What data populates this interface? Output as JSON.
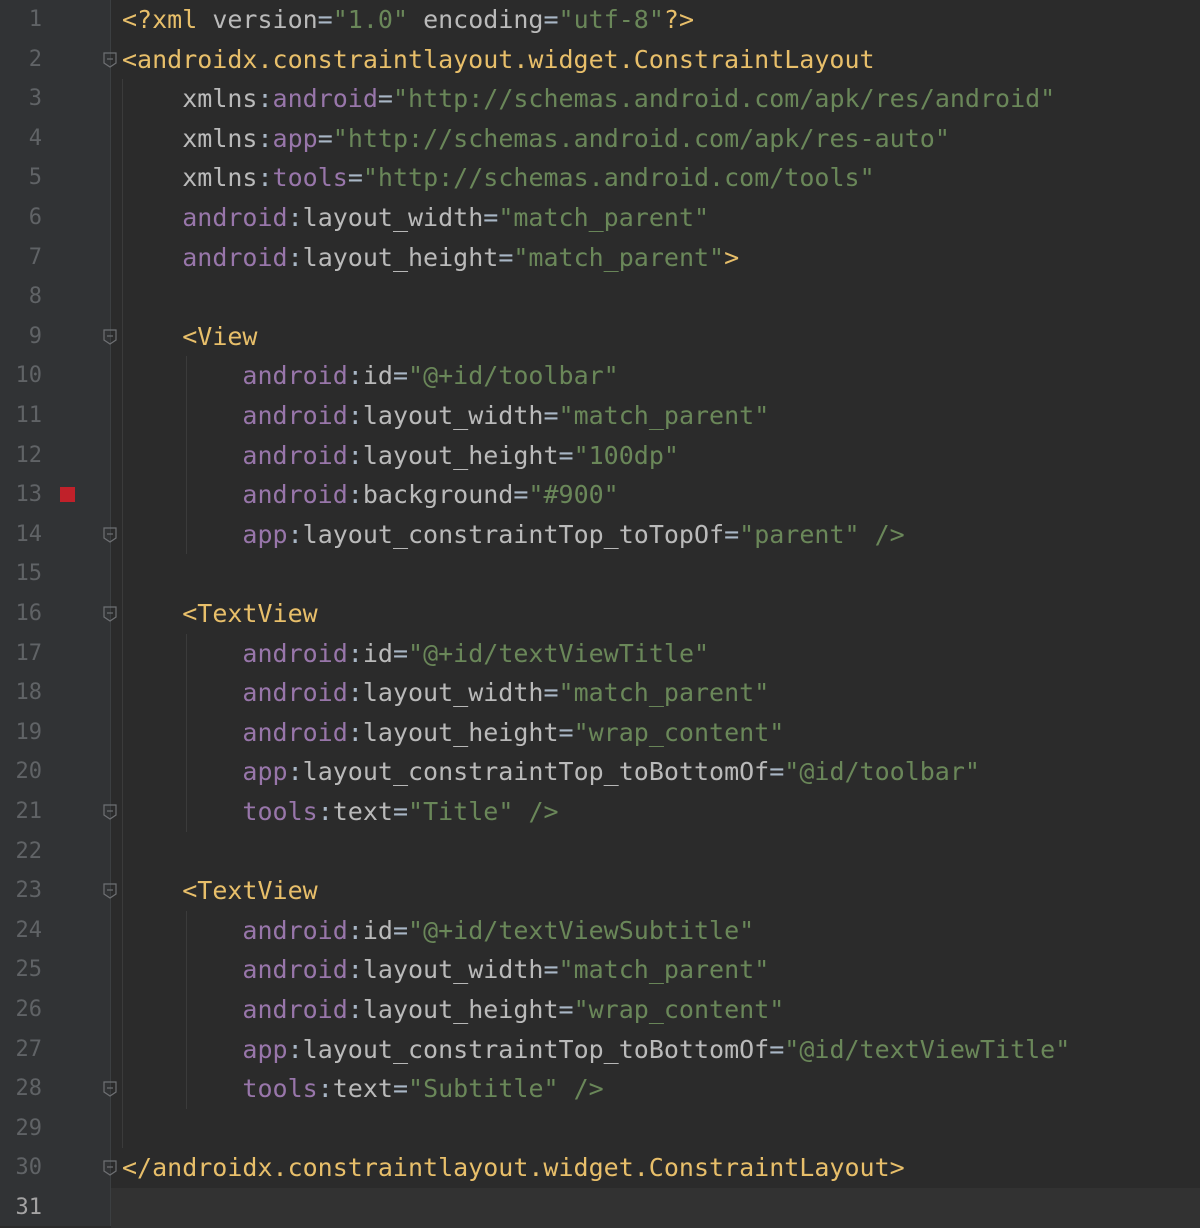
{
  "editor": {
    "language": "xml",
    "active_line": 31,
    "breakpoint_line": 13,
    "colors": {
      "background": "#2b2b2b",
      "gutter": "#313335",
      "tag": "#e8bf6a",
      "attribute": "#bababa",
      "namespace": "#9876aa",
      "value": "#6a8759",
      "line_number": "#606366",
      "breakpoint": "#c0212a"
    },
    "fold_markers": [
      2,
      9,
      14,
      16,
      21,
      23,
      28,
      30
    ],
    "line_numbers": [
      "1",
      "2",
      "3",
      "4",
      "5",
      "6",
      "7",
      "8",
      "9",
      "10",
      "11",
      "12",
      "13",
      "14",
      "15",
      "16",
      "17",
      "18",
      "19",
      "20",
      "21",
      "22",
      "23",
      "24",
      "25",
      "26",
      "27",
      "28",
      "29",
      "30",
      "31"
    ],
    "lines": [
      [
        [
          "tag",
          "<?xml "
        ],
        [
          "attr",
          "version"
        ],
        [
          "punct",
          "="
        ],
        [
          "val",
          "\"1.0\""
        ],
        [
          "punct",
          " "
        ],
        [
          "attr",
          "encoding"
        ],
        [
          "punct",
          "="
        ],
        [
          "val",
          "\"utf-8\""
        ],
        [
          "tag",
          "?>"
        ]
      ],
      [
        [
          "tag",
          "<androidx.constraintlayout.widget.ConstraintLayout"
        ]
      ],
      [
        [
          "punct",
          "    "
        ],
        [
          "attr",
          "xmlns"
        ],
        [
          "punct",
          ":"
        ],
        [
          "ns",
          "android"
        ],
        [
          "punct",
          "="
        ],
        [
          "val",
          "\"http://schemas.android.com/apk/res/android\""
        ]
      ],
      [
        [
          "punct",
          "    "
        ],
        [
          "attr",
          "xmlns"
        ],
        [
          "punct",
          ":"
        ],
        [
          "ns",
          "app"
        ],
        [
          "punct",
          "="
        ],
        [
          "val",
          "\"http://schemas.android.com/apk/res-auto\""
        ]
      ],
      [
        [
          "punct",
          "    "
        ],
        [
          "attr",
          "xmlns"
        ],
        [
          "punct",
          ":"
        ],
        [
          "ns",
          "tools"
        ],
        [
          "punct",
          "="
        ],
        [
          "val",
          "\"http://schemas.android.com/tools\""
        ]
      ],
      [
        [
          "punct",
          "    "
        ],
        [
          "ns",
          "android"
        ],
        [
          "punct",
          ":"
        ],
        [
          "attr",
          "layout_width"
        ],
        [
          "punct",
          "="
        ],
        [
          "val",
          "\"match_parent\""
        ]
      ],
      [
        [
          "punct",
          "    "
        ],
        [
          "ns",
          "android"
        ],
        [
          "punct",
          ":"
        ],
        [
          "attr",
          "layout_height"
        ],
        [
          "punct",
          "="
        ],
        [
          "val",
          "\"match_parent\""
        ],
        [
          "tag",
          ">"
        ]
      ],
      [],
      [
        [
          "punct",
          "    "
        ],
        [
          "tag",
          "<View"
        ]
      ],
      [
        [
          "punct",
          "        "
        ],
        [
          "ns",
          "android"
        ],
        [
          "punct",
          ":"
        ],
        [
          "attr",
          "id"
        ],
        [
          "punct",
          "="
        ],
        [
          "val",
          "\"@+id/toolbar\""
        ]
      ],
      [
        [
          "punct",
          "        "
        ],
        [
          "ns",
          "android"
        ],
        [
          "punct",
          ":"
        ],
        [
          "attr",
          "layout_width"
        ],
        [
          "punct",
          "="
        ],
        [
          "val",
          "\"match_parent\""
        ]
      ],
      [
        [
          "punct",
          "        "
        ],
        [
          "ns",
          "android"
        ],
        [
          "punct",
          ":"
        ],
        [
          "attr",
          "layout_height"
        ],
        [
          "punct",
          "="
        ],
        [
          "val",
          "\"100dp\""
        ]
      ],
      [
        [
          "punct",
          "        "
        ],
        [
          "ns",
          "android"
        ],
        [
          "punct",
          ":"
        ],
        [
          "attr",
          "background"
        ],
        [
          "punct",
          "="
        ],
        [
          "val",
          "\"#900\""
        ]
      ],
      [
        [
          "punct",
          "        "
        ],
        [
          "ns",
          "app"
        ],
        [
          "punct",
          ":"
        ],
        [
          "attr",
          "layout_constraintTop_toTopOf"
        ],
        [
          "punct",
          "="
        ],
        [
          "val",
          "\"parent\""
        ],
        [
          "punct",
          " "
        ],
        [
          "sl",
          "/>"
        ]
      ],
      [],
      [
        [
          "punct",
          "    "
        ],
        [
          "tag",
          "<TextView"
        ]
      ],
      [
        [
          "punct",
          "        "
        ],
        [
          "ns",
          "android"
        ],
        [
          "punct",
          ":"
        ],
        [
          "attr",
          "id"
        ],
        [
          "punct",
          "="
        ],
        [
          "val",
          "\"@+id/textViewTitle\""
        ]
      ],
      [
        [
          "punct",
          "        "
        ],
        [
          "ns",
          "android"
        ],
        [
          "punct",
          ":"
        ],
        [
          "attr",
          "layout_width"
        ],
        [
          "punct",
          "="
        ],
        [
          "val",
          "\"match_parent\""
        ]
      ],
      [
        [
          "punct",
          "        "
        ],
        [
          "ns",
          "android"
        ],
        [
          "punct",
          ":"
        ],
        [
          "attr",
          "layout_height"
        ],
        [
          "punct",
          "="
        ],
        [
          "val",
          "\"wrap_content\""
        ]
      ],
      [
        [
          "punct",
          "        "
        ],
        [
          "ns",
          "app"
        ],
        [
          "punct",
          ":"
        ],
        [
          "attr",
          "layout_constraintTop_toBottomOf"
        ],
        [
          "punct",
          "="
        ],
        [
          "val",
          "\"@id/toolbar\""
        ]
      ],
      [
        [
          "punct",
          "        "
        ],
        [
          "ns",
          "tools"
        ],
        [
          "punct",
          ":"
        ],
        [
          "attr",
          "text"
        ],
        [
          "punct",
          "="
        ],
        [
          "val",
          "\"Title\""
        ],
        [
          "punct",
          " "
        ],
        [
          "sl",
          "/>"
        ]
      ],
      [],
      [
        [
          "punct",
          "    "
        ],
        [
          "tag",
          "<TextView"
        ]
      ],
      [
        [
          "punct",
          "        "
        ],
        [
          "ns",
          "android"
        ],
        [
          "punct",
          ":"
        ],
        [
          "attr",
          "id"
        ],
        [
          "punct",
          "="
        ],
        [
          "val",
          "\"@+id/textViewSubtitle\""
        ]
      ],
      [
        [
          "punct",
          "        "
        ],
        [
          "ns",
          "android"
        ],
        [
          "punct",
          ":"
        ],
        [
          "attr",
          "layout_width"
        ],
        [
          "punct",
          "="
        ],
        [
          "val",
          "\"match_parent\""
        ]
      ],
      [
        [
          "punct",
          "        "
        ],
        [
          "ns",
          "android"
        ],
        [
          "punct",
          ":"
        ],
        [
          "attr",
          "layout_height"
        ],
        [
          "punct",
          "="
        ],
        [
          "val",
          "\"wrap_content\""
        ]
      ],
      [
        [
          "punct",
          "        "
        ],
        [
          "ns",
          "app"
        ],
        [
          "punct",
          ":"
        ],
        [
          "attr",
          "layout_constraintTop_toBottomOf"
        ],
        [
          "punct",
          "="
        ],
        [
          "val",
          "\"@id/textViewTitle\""
        ]
      ],
      [
        [
          "punct",
          "        "
        ],
        [
          "ns",
          "tools"
        ],
        [
          "punct",
          ":"
        ],
        [
          "attr",
          "text"
        ],
        [
          "punct",
          "="
        ],
        [
          "val",
          "\"Subtitle\""
        ],
        [
          "punct",
          " "
        ],
        [
          "sl",
          "/>"
        ]
      ],
      [],
      [
        [
          "tag",
          "</androidx.constraintlayout.widget.ConstraintLayout>"
        ]
      ],
      []
    ]
  }
}
